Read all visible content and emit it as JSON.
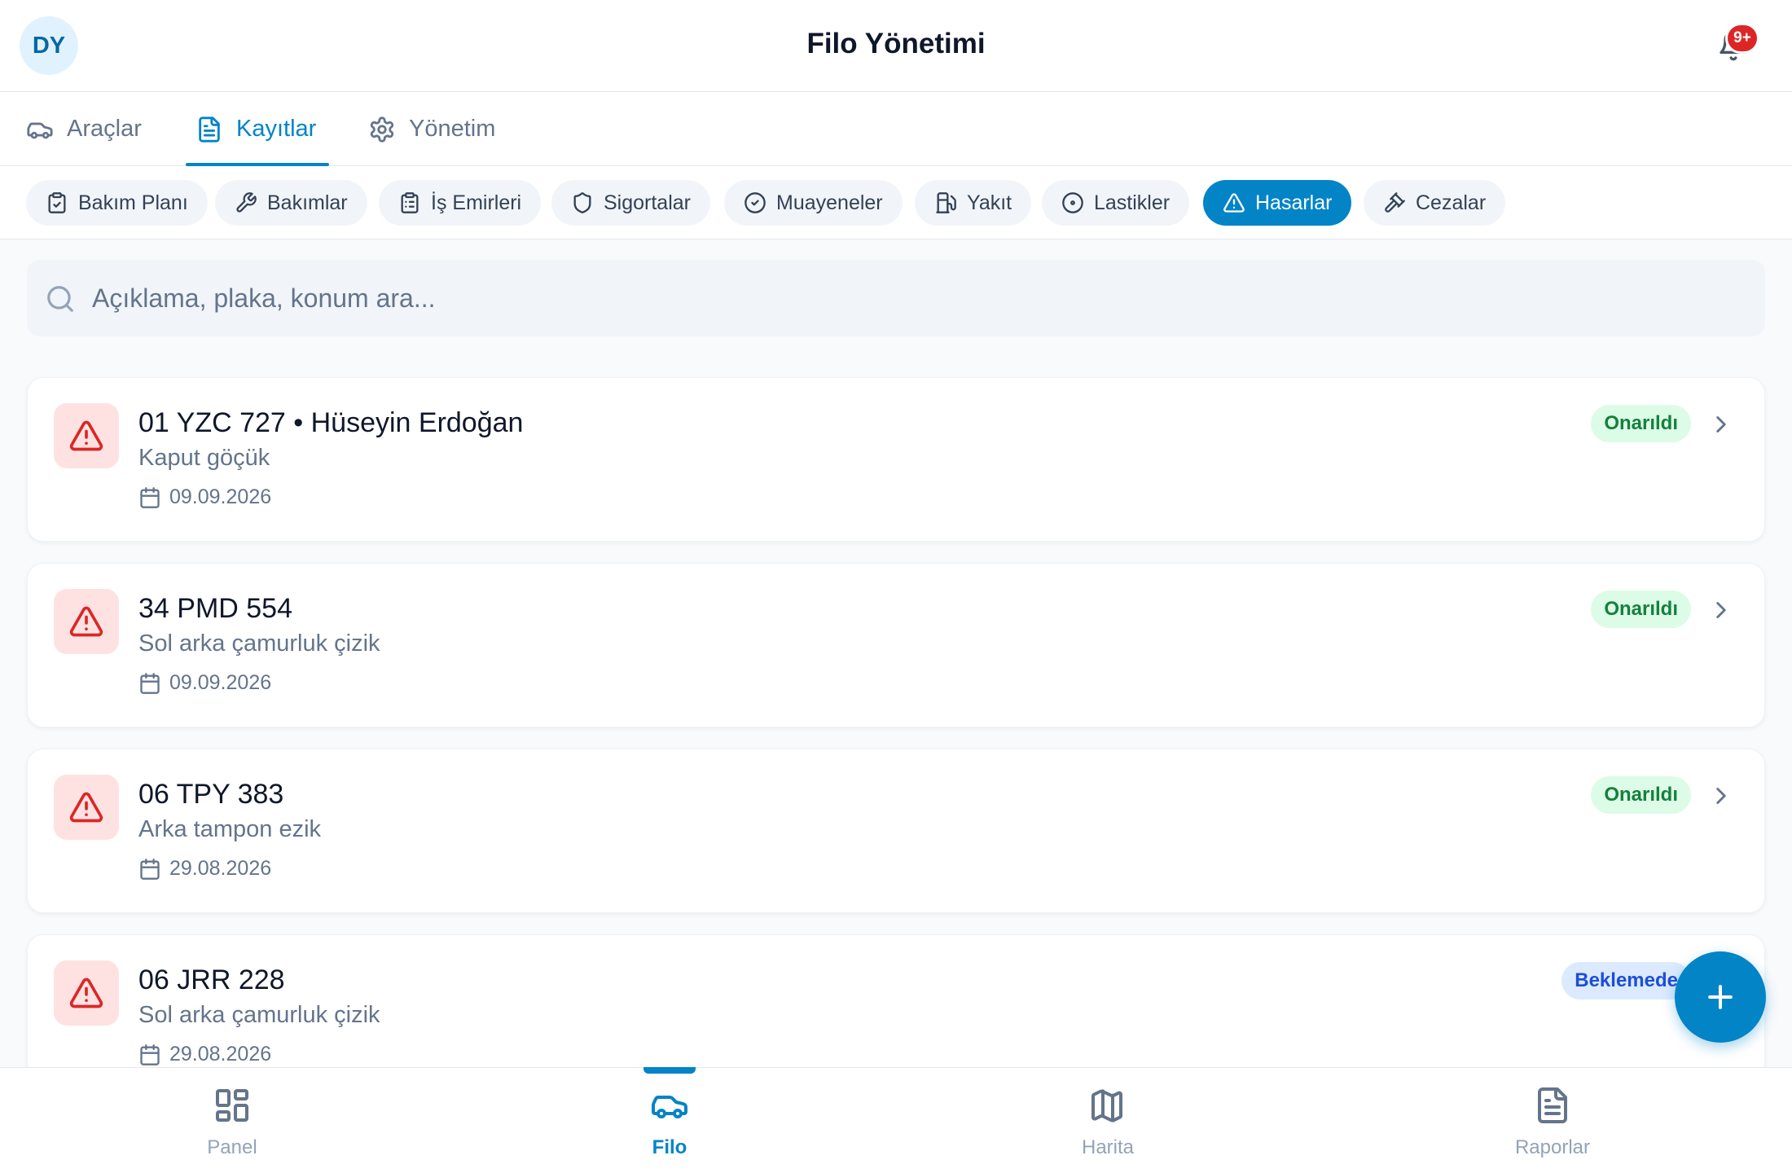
{
  "header": {
    "avatar_initials": "DY",
    "title": "Filo Yönetimi",
    "notification_badge": "9+"
  },
  "tabs": [
    {
      "label": "Araçlar",
      "icon": "car-icon",
      "active": false
    },
    {
      "label": "Kayıtlar",
      "icon": "document-icon",
      "active": true
    },
    {
      "label": "Yönetim",
      "icon": "gear-icon",
      "active": false
    }
  ],
  "chips": [
    {
      "label": "Bakım Planı",
      "icon": "clipboard-check-icon"
    },
    {
      "label": "Bakımlar",
      "icon": "wrench-icon"
    },
    {
      "label": "İş Emirleri",
      "icon": "clipboard-list-icon"
    },
    {
      "label": "Sigortalar",
      "icon": "shield-icon"
    },
    {
      "label": "Muayeneler",
      "icon": "check-circle-icon"
    },
    {
      "label": "Yakıt",
      "icon": "fuel-icon"
    },
    {
      "label": "Lastikler",
      "icon": "tire-icon"
    },
    {
      "label": "Hasarlar",
      "icon": "warning-icon",
      "active": true
    },
    {
      "label": "Cezalar",
      "icon": "gavel-icon"
    }
  ],
  "search": {
    "placeholder": "Açıklama, plaka, konum ara..."
  },
  "records": [
    {
      "title": "01 YZC 727 • Hüseyin Erdoğan",
      "description": "Kaput göçük",
      "date": "09.09.2026",
      "status": "Onarıldı"
    },
    {
      "title": "34 PMD 554",
      "description": "Sol arka çamurluk çizik",
      "date": "09.09.2026",
      "status": "Onarıldı"
    },
    {
      "title": "06 TPY 383",
      "description": "Arka tampon ezik",
      "date": "29.08.2026",
      "status": "Onarıldı"
    },
    {
      "title": "06 JRR 228",
      "description": "Sol arka çamurluk çizik",
      "date": "29.08.2026",
      "status": "Beklemede"
    }
  ],
  "bottom_nav": [
    {
      "label": "Panel",
      "icon": "grid-icon"
    },
    {
      "label": "Filo",
      "icon": "car-icon",
      "active": true
    },
    {
      "label": "Harita",
      "icon": "map-icon"
    },
    {
      "label": "Raporlar",
      "icon": "report-icon"
    }
  ],
  "colors": {
    "accent": "#0284c7",
    "danger_bg": "#fee2e2",
    "danger": "#dc2626",
    "repaired_bg": "#dcfce7",
    "repaired_text": "#15803d",
    "pending_bg": "#dbeafe",
    "pending_text": "#1d4ed8"
  }
}
